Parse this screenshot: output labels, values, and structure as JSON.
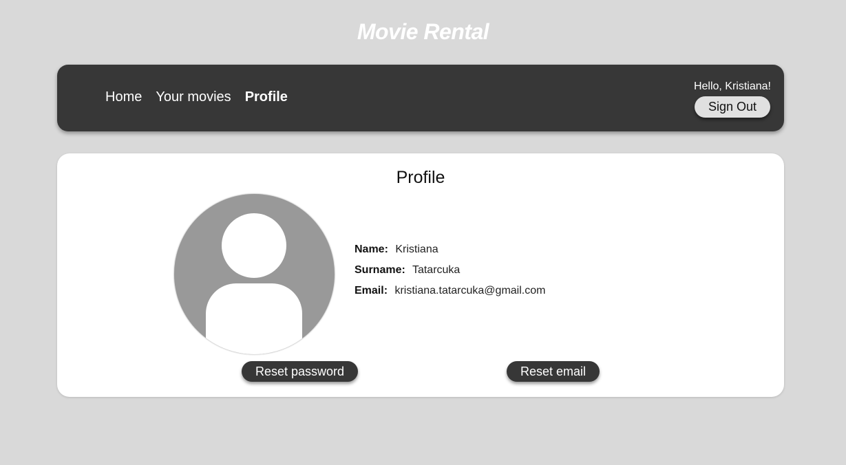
{
  "app": {
    "title": "Movie Rental"
  },
  "nav": {
    "links": [
      {
        "label": "Home",
        "active": false
      },
      {
        "label": "Your movies",
        "active": false
      },
      {
        "label": "Profile",
        "active": true
      }
    ],
    "greeting": "Hello, Kristiana!",
    "signout_label": "Sign Out"
  },
  "profile": {
    "heading": "Profile",
    "avatar_icon": "default-user-avatar-icon",
    "fields": [
      {
        "label": "Name:",
        "value": "Kristiana"
      },
      {
        "label": "Surname:",
        "value": "Tatarcuka"
      },
      {
        "label": "Email:",
        "value": "kristiana.tatarcuka@gmail.com"
      }
    ],
    "reset_password_label": "Reset password",
    "reset_email_label": "Reset email"
  },
  "colors": {
    "background": "#d9d9d9",
    "navbar": "#373737",
    "card": "#ffffff",
    "avatar": "#999999",
    "button_dark": "#373737",
    "button_light": "#e0e0e0"
  }
}
